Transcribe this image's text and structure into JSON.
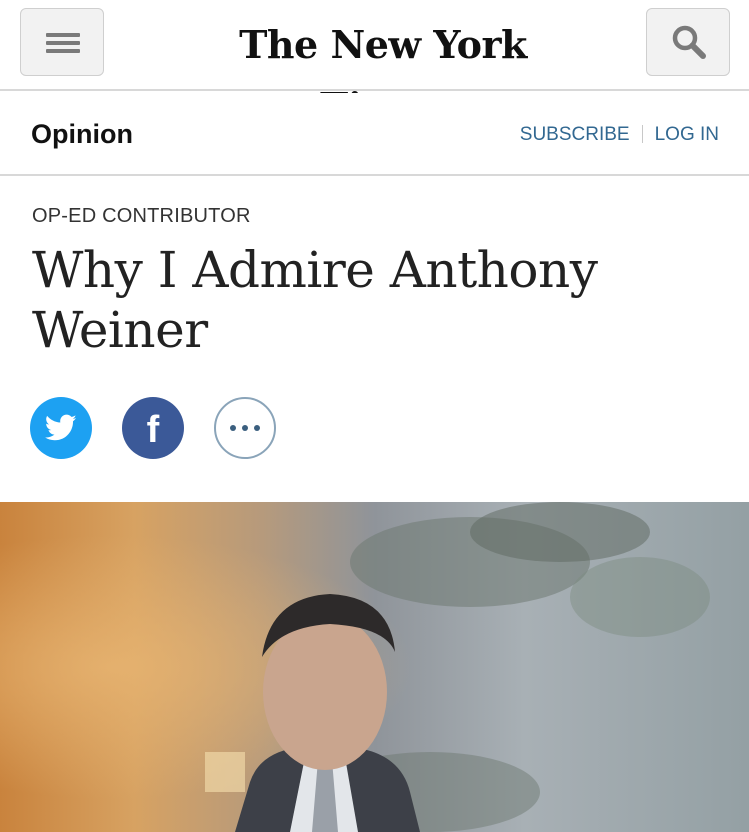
{
  "masthead": {
    "logo_text": "The New York Times",
    "menu_icon": "hamburger-menu-icon",
    "search_icon": "search-icon"
  },
  "section_bar": {
    "section": "Opinion",
    "subscribe": "SUBSCRIBE",
    "login": "LOG IN",
    "link_color": "#326891"
  },
  "article": {
    "kicker": "OP-ED CONTRIBUTOR",
    "headline": "Why I Admire Anthony Weiner"
  },
  "share": {
    "twitter_icon": "twitter-bird-icon",
    "facebook_icon": "facebook-f-icon",
    "more_icon": "more-dots-icon",
    "facebook_glyph": "f",
    "twitter_color": "#1da1f2",
    "facebook_color": "#3b5998"
  },
  "photo": {
    "description_icon": "article-photo"
  }
}
